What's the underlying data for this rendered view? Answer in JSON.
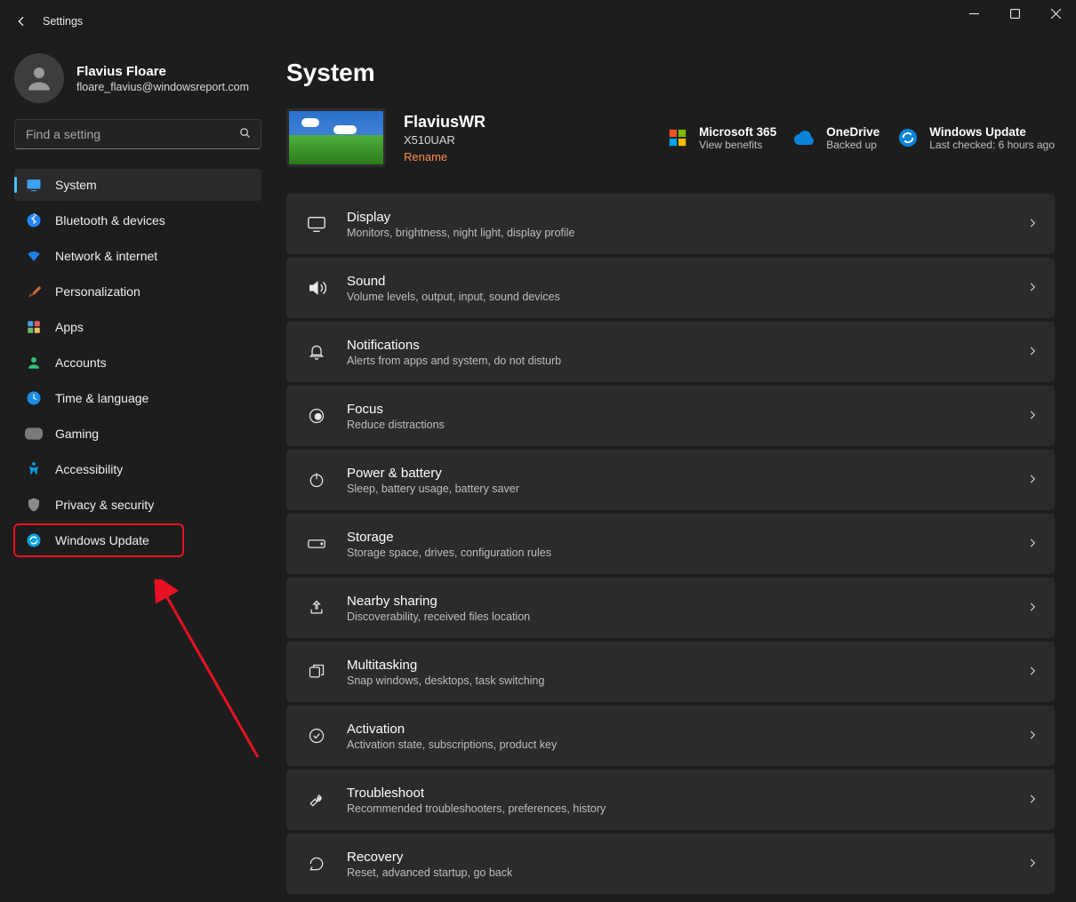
{
  "window": {
    "title": "Settings"
  },
  "user": {
    "name": "Flavius Floare",
    "email": "floare_flavius@windowsreport.com"
  },
  "search": {
    "placeholder": "Find a setting"
  },
  "nav": {
    "items": [
      {
        "label": "System"
      },
      {
        "label": "Bluetooth & devices"
      },
      {
        "label": "Network & internet"
      },
      {
        "label": "Personalization"
      },
      {
        "label": "Apps"
      },
      {
        "label": "Accounts"
      },
      {
        "label": "Time & language"
      },
      {
        "label": "Gaming"
      },
      {
        "label": "Accessibility"
      },
      {
        "label": "Privacy & security"
      },
      {
        "label": "Windows Update"
      }
    ]
  },
  "page": {
    "title": "System"
  },
  "device": {
    "name": "FlaviusWR",
    "model": "X510UAR",
    "rename": "Rename"
  },
  "status": {
    "m365": {
      "title": "Microsoft 365",
      "sub": "View benefits"
    },
    "onedrive": {
      "title": "OneDrive",
      "sub": "Backed up"
    },
    "wupdate": {
      "title": "Windows Update",
      "sub": "Last checked: 6 hours ago"
    }
  },
  "cards": {
    "display": {
      "title": "Display",
      "sub": "Monitors, brightness, night light, display profile"
    },
    "sound": {
      "title": "Sound",
      "sub": "Volume levels, output, input, sound devices"
    },
    "notifications": {
      "title": "Notifications",
      "sub": "Alerts from apps and system, do not disturb"
    },
    "focus": {
      "title": "Focus",
      "sub": "Reduce distractions"
    },
    "power": {
      "title": "Power & battery",
      "sub": "Sleep, battery usage, battery saver"
    },
    "storage": {
      "title": "Storage",
      "sub": "Storage space, drives, configuration rules"
    },
    "nearby": {
      "title": "Nearby sharing",
      "sub": "Discoverability, received files location"
    },
    "multitasking": {
      "title": "Multitasking",
      "sub": "Snap windows, desktops, task switching"
    },
    "activation": {
      "title": "Activation",
      "sub": "Activation state, subscriptions, product key"
    },
    "troubleshoot": {
      "title": "Troubleshoot",
      "sub": "Recommended troubleshooters, preferences, history"
    },
    "recovery": {
      "title": "Recovery",
      "sub": "Reset, advanced startup, go back"
    }
  }
}
